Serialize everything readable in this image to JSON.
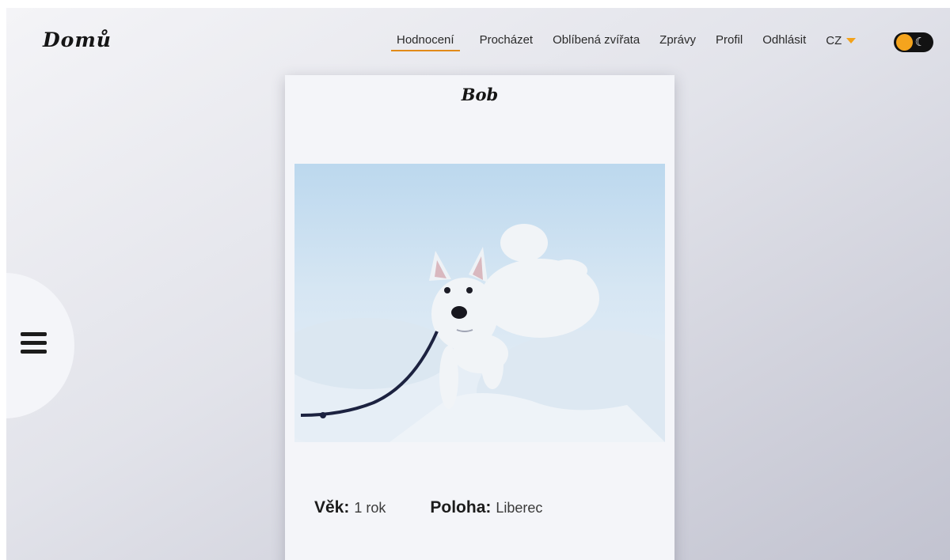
{
  "header": {
    "logo": "Domů",
    "nav": [
      {
        "label": "Hodnocení",
        "active": true
      },
      {
        "label": "Procházet",
        "active": false
      },
      {
        "label": "Oblíbená zvířata",
        "active": false
      },
      {
        "label": "Zprávy",
        "active": false
      },
      {
        "label": "Profil",
        "active": false
      },
      {
        "label": "Odhlásit",
        "active": false
      }
    ],
    "language": "CZ",
    "theme_toggle_icon": "☾"
  },
  "sidebar": {
    "menu_icon": "hamburger-icon"
  },
  "card": {
    "name": "Bob",
    "age_label": "Věk:",
    "age_value": "1 rok",
    "location_label": "Poloha:",
    "location_value": "Liberec"
  },
  "colors": {
    "accent": "#e28a19",
    "toggle_knob": "#f5a41d",
    "toggle_bg": "#121212"
  }
}
